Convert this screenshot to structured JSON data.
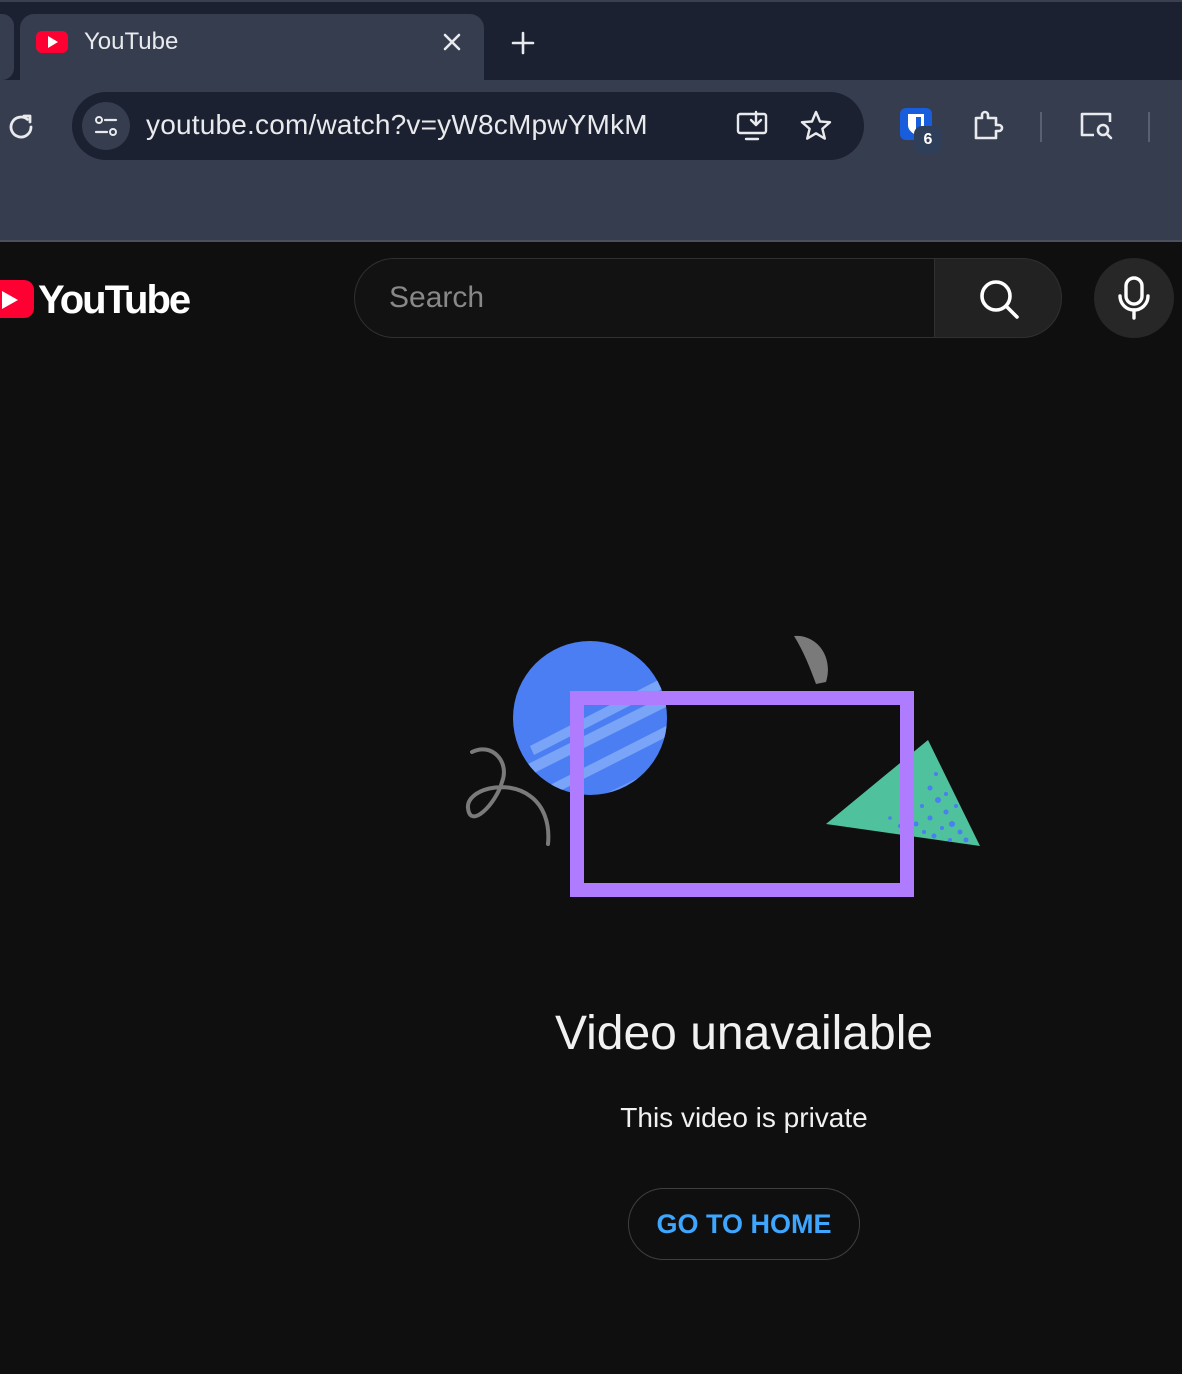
{
  "browser": {
    "tab": {
      "title": "YouTube",
      "favicon": "youtube-favicon"
    },
    "address_bar": {
      "url": "youtube.com/watch?v=yW8cMpwYMkM"
    },
    "extensions": {
      "bitwarden_badge": "6"
    },
    "icons": [
      "reload-icon",
      "site-info-icon",
      "install-app-icon",
      "bookmark-star-icon",
      "bitwarden-icon",
      "extensions-puzzle-icon",
      "search-tab-icon",
      "close-icon",
      "new-tab-icon"
    ]
  },
  "youtube": {
    "logo_text": "YouTube",
    "search": {
      "placeholder": "Search"
    },
    "icons": [
      "search-icon",
      "microphone-icon"
    ]
  },
  "error": {
    "title": "Video unavailable",
    "message": "This video is private",
    "home_button": "GO TO HOME"
  },
  "colors": {
    "background": "#0f0f0f",
    "youtube_red": "#ff0033",
    "link_blue": "#3ea6ff",
    "frame_purple": "#b07cff",
    "circle_blue": "#4a7ef2",
    "triangle_teal": "#4fc19c"
  }
}
